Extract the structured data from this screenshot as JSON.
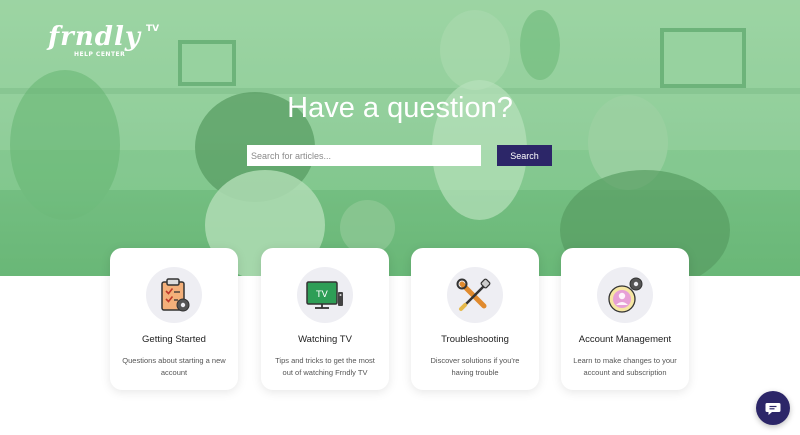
{
  "brand": {
    "logo_text": "frndly",
    "logo_tv": "TV",
    "logo_subtitle": "HELP CENTER",
    "accent_color": "#2c2668",
    "hero_tint": "#8ccb97"
  },
  "hero": {
    "headline": "Have a question?",
    "search_placeholder": "Search for articles...",
    "search_button_label": "Search"
  },
  "categories": [
    {
      "title": "Getting Started",
      "description": "Questions about starting a new account",
      "icon": "clipboard-checklist-icon"
    },
    {
      "title": "Watching TV",
      "description": "Tips and tricks to get the most out of watching Frndly TV",
      "icon": "tv-icon"
    },
    {
      "title": "Troubleshooting",
      "description": "Discover solutions if you're having trouble",
      "icon": "wrench-screwdriver-icon"
    },
    {
      "title": "Account Management",
      "description": "Learn to make changes to your account and subscription",
      "icon": "user-settings-icon"
    }
  ],
  "chat": {
    "icon": "chat-bubble-icon"
  }
}
